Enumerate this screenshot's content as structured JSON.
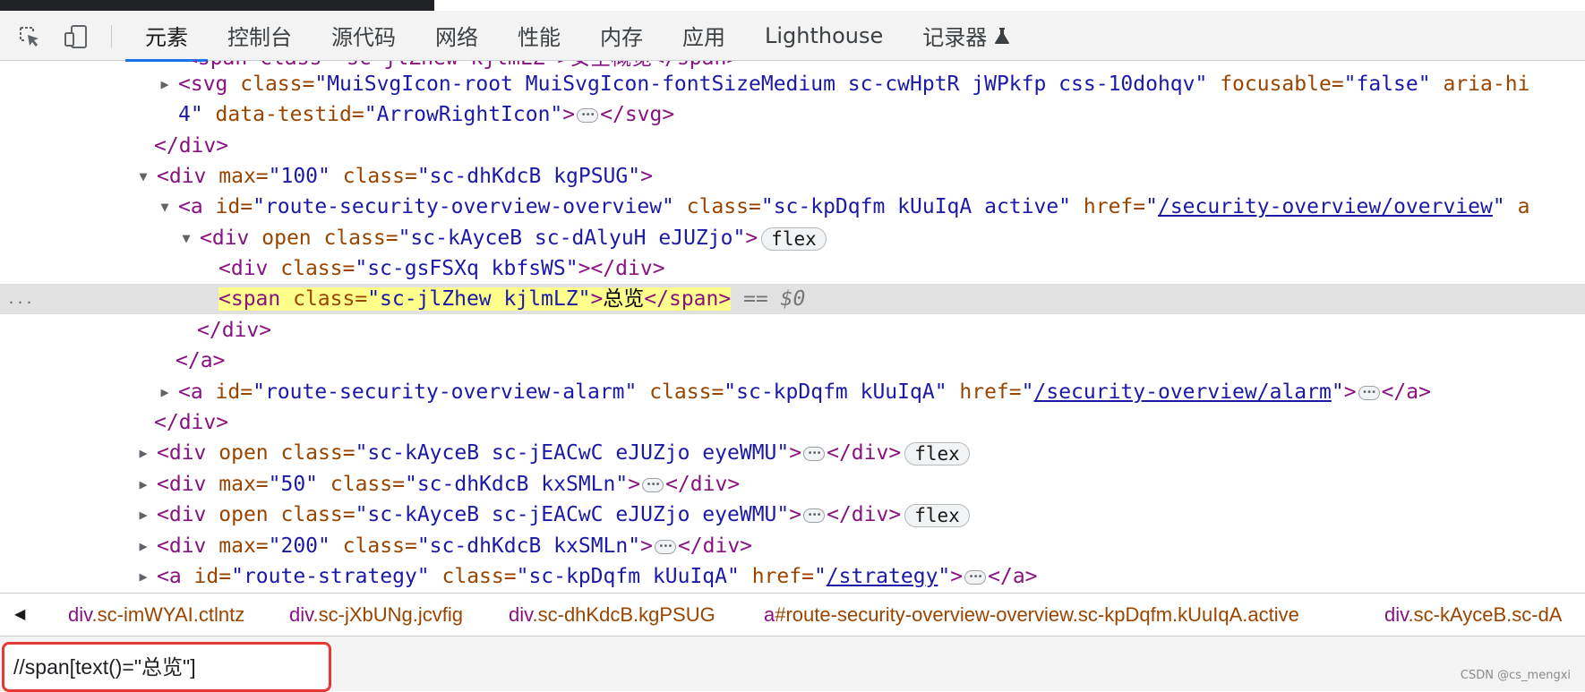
{
  "devtools": {
    "tabs": [
      {
        "label": "元素"
      },
      {
        "label": "控制台"
      },
      {
        "label": "源代码"
      },
      {
        "label": "网络"
      },
      {
        "label": "性能"
      },
      {
        "label": "内存"
      },
      {
        "label": "应用"
      },
      {
        "label": "Lighthouse"
      },
      {
        "label": "记录器"
      }
    ],
    "active_tab": "元素",
    "icons": {
      "inspect": "inspect-element-icon",
      "device": "device-toolbar-icon",
      "recorder_badge": "flask-icon"
    }
  },
  "tree": {
    "line0": {
      "cut_text": "<span class=\"sc-jlZhew kjlmLZ\">安全概览</span>"
    },
    "line1": {
      "tag_open": "<svg ",
      "attr1": "class=",
      "val1": "\"MuiSvgIcon-root MuiSvgIcon-fontSizeMedium sc-cwHptR jWPkfp css-10dohqv\"",
      "attr2": " focusable=",
      "val2": "\"false\"",
      "attr3": " aria-hi"
    },
    "line2": {
      "val_end": "4\"",
      "attr": " data-testid=",
      "val": "\"ArrowRightIcon\"",
      "gt": ">",
      "close": "</svg>"
    },
    "line3": {
      "close": "</div>"
    },
    "line4": {
      "tag_open": "<div ",
      "attr1": "max=",
      "val1": "\"100\"",
      "attr2": " class=",
      "val2": "\"sc-dhKdcB kgPSUG\"",
      "gt": ">"
    },
    "line5": {
      "tag_open": "<a ",
      "attr1": "id=",
      "val1": "\"route-security-overview-overview\"",
      "attr2": " class=",
      "val2": "\"sc-kpDqfm kUuIqA active\"",
      "attr3": " href=",
      "q1": "\"",
      "link": "/security-overview/overview",
      "q2": "\"",
      "tail": " a"
    },
    "line6": {
      "tag_open": "<div ",
      "attr1": "open class=",
      "val1": "\"sc-kAyceB sc-dAlyuH eJUZjo\"",
      "gt": ">",
      "badge": "flex"
    },
    "line7": {
      "tag_open": "<div ",
      "attr1": "class=",
      "val1": "\"sc-gsFSXq kbfsWS\"",
      "gt": ">",
      "close": "</div>"
    },
    "line8": {
      "tag_open": "<span ",
      "attr1": "class=",
      "val1": "\"sc-jlZhew kjlmLZ\"",
      "gt": ">",
      "text": "总览",
      "close": "</span>",
      "eq": " == ",
      "dollar": "$0",
      "gutter": "..."
    },
    "line9": {
      "close": "</div>"
    },
    "line10": {
      "close": "</a>"
    },
    "line11": {
      "tag_open": "<a ",
      "attr1": "id=",
      "val1": "\"route-security-overview-alarm\"",
      "attr2": " class=",
      "val2": "\"sc-kpDqfm kUuIqA\"",
      "attr3": " href=",
      "q1": "\"",
      "link": "/security-overview/alarm",
      "q2": "\"",
      "gt": ">",
      "close": "</a>"
    },
    "line12": {
      "close": "</div>"
    },
    "line13": {
      "tag_open": "<div ",
      "attr1": "open class=",
      "val1": "\"sc-kAyceB sc-jEACwC eJUZjo eyeWMU\"",
      "gt": ">",
      "close": "</div>",
      "badge": "flex"
    },
    "line14": {
      "tag_open": "<div ",
      "attr1": "max=",
      "val1": "\"50\"",
      "attr2": " class=",
      "val2": "\"sc-dhKdcB kxSMLn\"",
      "gt": ">",
      "close": "</div>"
    },
    "line15": {
      "tag_open": "<div ",
      "attr1": "open class=",
      "val1": "\"sc-kAyceB sc-jEACwC eJUZjo eyeWMU\"",
      "gt": ">",
      "close": "</div>",
      "badge": "flex"
    },
    "line16": {
      "tag_open": "<div ",
      "attr1": "max=",
      "val1": "\"200\"",
      "attr2": " class=",
      "val2": "\"sc-dhKdcB kxSMLn\"",
      "gt": ">",
      "close": "</div>"
    },
    "line17": {
      "tag_open": "<a ",
      "attr1": "id=",
      "val1": "\"route-strategy\"",
      "attr2": " class=",
      "val2": "\"sc-kpDqfm kUuIqA\"",
      "attr3": " href=",
      "q1": "\"",
      "link": "/strategy",
      "q2": "\"",
      "gt": ">",
      "close": "</a>"
    }
  },
  "breadcrumb": {
    "items": [
      {
        "tag": "div",
        "cls": ".sc-imWYAI.ctlntz"
      },
      {
        "tag": "div",
        "cls": ".sc-jXbUNg.jcvfig"
      },
      {
        "tag": "div",
        "cls": ".sc-dhKdcB.kgPSUG"
      },
      {
        "tag": "a",
        "cls": "#route-security-overview-overview.sc-kpDqfm.kUuIqA.active"
      },
      {
        "tag": "div",
        "cls": ".sc-kAyceB.sc-dA"
      }
    ]
  },
  "search": {
    "value": "//span[text()=\"总览\"]"
  },
  "watermark": "CSDN @cs_mengxi"
}
